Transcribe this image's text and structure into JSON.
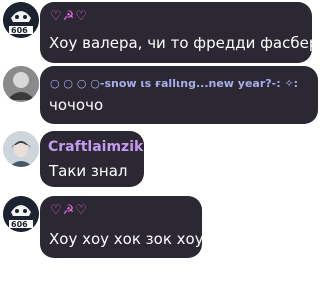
{
  "messages": [
    {
      "sender": "♡☭♡",
      "text": "Хоу валера, чи то фредди фасбер",
      "avatar_label": "606",
      "name_color": "#e06dd8"
    },
    {
      "sender": "○ ○ ○ ○-ѕnow ιѕ ғallιng...new year?-: ✧:",
      "text": "чочочо",
      "avatar_label": "",
      "name_color": "#a9aeeb"
    },
    {
      "sender": "Craftlaimzik",
      "text": "Таки знал",
      "avatar_label": "",
      "name_color": "#c39bef"
    },
    {
      "sender": "♡☭♡",
      "text": "Хоу хоу хок зок хоу",
      "avatar_label": "606",
      "name_color": "#e06dd8"
    }
  ]
}
